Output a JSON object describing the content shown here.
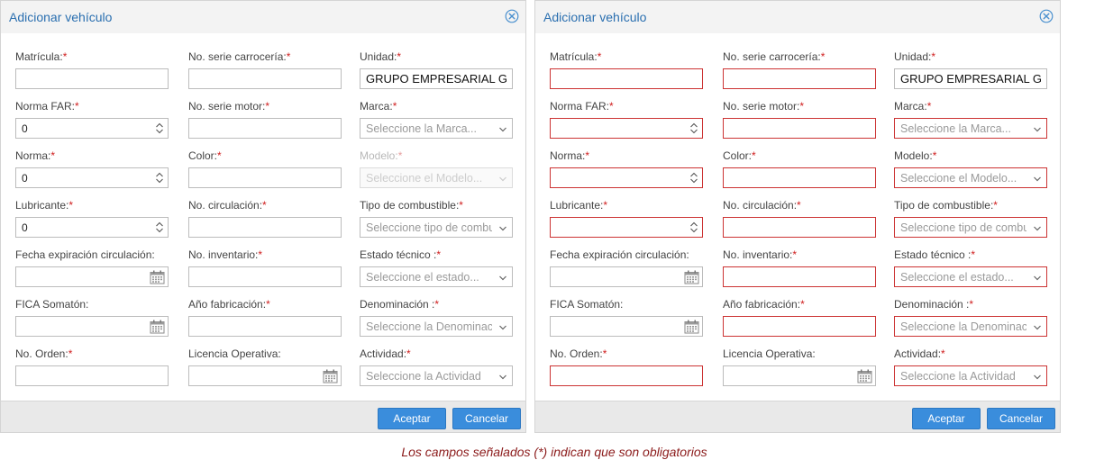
{
  "dialogs": [
    {
      "title": "Adicionar vehículo",
      "ok_label": "Aceptar",
      "cancel_label": "Cancelar",
      "fields": {
        "matricula": {
          "label": "Matrícula:",
          "req": "*",
          "value": ""
        },
        "serie_carroceria": {
          "label": "No. serie carrocería:",
          "req": "*",
          "value": ""
        },
        "unidad": {
          "label": "Unidad:",
          "req": "*",
          "value": "GRUPO EMPRESARIAL GEOCUBA"
        },
        "norma_far": {
          "label": "Norma FAR:",
          "req": "*",
          "value": "0"
        },
        "serie_motor": {
          "label": "No. serie motor:",
          "req": "*",
          "value": ""
        },
        "marca": {
          "label": "Marca:",
          "req": "*",
          "placeholder": "Seleccione la Marca..."
        },
        "norma": {
          "label": "Norma:",
          "req": "*",
          "value": "0"
        },
        "color": {
          "label": "Color:",
          "req": "*",
          "value": ""
        },
        "modelo": {
          "label": "Modelo:",
          "req": "*",
          "placeholder": "Seleccione el Modelo..."
        },
        "lubricante": {
          "label": "Lubricante:",
          "req": "*",
          "value": "0"
        },
        "circulacion": {
          "label": "No. circulación:",
          "req": "*",
          "value": ""
        },
        "combustible": {
          "label": "Tipo de combustible:",
          "req": "*",
          "placeholder": "Seleccione tipo de combustible"
        },
        "fecha_exp": {
          "label": "Fecha  expiración circulación:",
          "req": "",
          "value": ""
        },
        "inventario": {
          "label": "No. inventario:",
          "req": "*",
          "value": ""
        },
        "estado": {
          "label": "Estado técnico :",
          "req": "*",
          "placeholder": "Seleccione el estado..."
        },
        "fica": {
          "label": "FICA Somatón:",
          "req": "",
          "value": ""
        },
        "anio": {
          "label": "Año fabricación:",
          "req": "*",
          "value": ""
        },
        "denominacion": {
          "label": "Denominación :",
          "req": "*",
          "placeholder": "Seleccione la Denominación"
        },
        "orden": {
          "label": "No. Orden:",
          "req": "*",
          "value": ""
        },
        "licencia": {
          "label": "Licencia Operativa:",
          "req": "",
          "value": ""
        },
        "actividad": {
          "label": "Actividad:",
          "req": "*",
          "placeholder": "Seleccione la Actividad"
        }
      }
    },
    {
      "title": "Adicionar vehículo",
      "ok_label": "Aceptar",
      "cancel_label": "Cancelar",
      "fields": {
        "matricula": {
          "label": "Matrícula:",
          "req": "*",
          "value": ""
        },
        "serie_carroceria": {
          "label": "No. serie carrocería:",
          "req": "*",
          "value": ""
        },
        "unidad": {
          "label": "Unidad:",
          "req": "*",
          "value": "GRUPO EMPRESARIAL GEOCUBA"
        },
        "norma_far": {
          "label": "Norma FAR:",
          "req": "*",
          "value": ""
        },
        "serie_motor": {
          "label": "No. serie motor:",
          "req": "*",
          "value": ""
        },
        "marca": {
          "label": "Marca:",
          "req": "*",
          "placeholder": "Seleccione la Marca..."
        },
        "norma": {
          "label": "Norma:",
          "req": "*",
          "value": ""
        },
        "color": {
          "label": "Color:",
          "req": "*",
          "value": ""
        },
        "modelo": {
          "label": "Modelo:",
          "req": "*",
          "placeholder": "Seleccione el Modelo..."
        },
        "lubricante": {
          "label": "Lubricante:",
          "req": "*",
          "value": ""
        },
        "circulacion": {
          "label": "No. circulación:",
          "req": "*",
          "value": ""
        },
        "combustible": {
          "label": "Tipo de combustible:",
          "req": "*",
          "placeholder": "Seleccione tipo de combustible"
        },
        "fecha_exp": {
          "label": "Fecha  expiración circulación:",
          "req": "",
          "value": ""
        },
        "inventario": {
          "label": "No. inventario:",
          "req": "*",
          "value": ""
        },
        "estado": {
          "label": "Estado técnico :",
          "req": "*",
          "placeholder": "Seleccione el estado..."
        },
        "fica": {
          "label": "FICA Somatón:",
          "req": "",
          "value": ""
        },
        "anio": {
          "label": "Año fabricación:",
          "req": "*",
          "value": ""
        },
        "denominacion": {
          "label": "Denominación :",
          "req": "*",
          "placeholder": "Seleccione la Denominación"
        },
        "orden": {
          "label": "No. Orden:",
          "req": "*",
          "value": ""
        },
        "licencia": {
          "label": "Licencia Operativa:",
          "req": "",
          "value": ""
        },
        "actividad": {
          "label": "Actividad:",
          "req": "*",
          "placeholder": "Seleccione la Actividad"
        }
      }
    }
  ],
  "footnote": "Los campos señalados (*) indican que son obligatorios",
  "colors": {
    "title": "#2a6fb0",
    "required": "#d02020",
    "invalid_border": "#cc3333",
    "button": "#3a8ddc",
    "footnote": "#8b1a1a"
  },
  "icons": {
    "close": "close-circle-icon",
    "spinner": "spinner-arrows-icon",
    "calendar": "calendar-icon",
    "dropdown": "chevron-down-icon"
  }
}
